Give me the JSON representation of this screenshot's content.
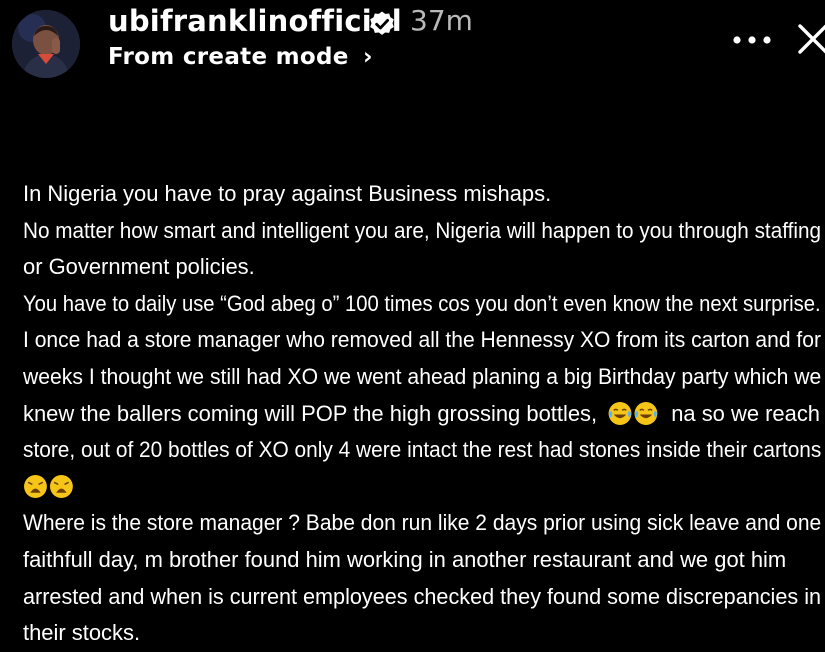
{
  "header": {
    "username": "ubifranklinofficial",
    "verified_icon": "verified-badge-icon",
    "time_ago": "37m",
    "subtitle": "From create mode",
    "subtitle_chevron": "›",
    "more_icon": "more-horizontal-icon",
    "close_icon": "close-icon"
  },
  "caption": {
    "lines": [
      "In Nigeria you have to pray against Business mishaps.",
      "No matter how smart and intelligent you are, Nigeria will happen to you through staffing",
      "or Government policies.",
      "You have to daily use “God abeg o” 100 times cos you don’t even know the next surprise.",
      "I once had a store manager who removed all the Hennessy XO from its carton and for",
      "weeks I thought we still had XO we went ahead planing a big Birthday party which we",
      "knew the ballers coming will POP the high grossing bottles,",
      "na so we reach",
      "store, out of 20 bottles of XO only 4 were intact the rest had stones inside their cartons",
      "Where is the store manager ? Babe don run like 2 days prior using sick leave and one",
      "faithfull day, m brother found him working in another restaurant and we got him",
      "arrested and when is current employees checked they found some discrepancies in",
      "their stocks."
    ],
    "emoji_laughing": "😂😂",
    "emoji_weary": "😩😩"
  },
  "colors": {
    "background": "#000000",
    "text": "#ffffff",
    "muted": "#b9b9b9"
  }
}
